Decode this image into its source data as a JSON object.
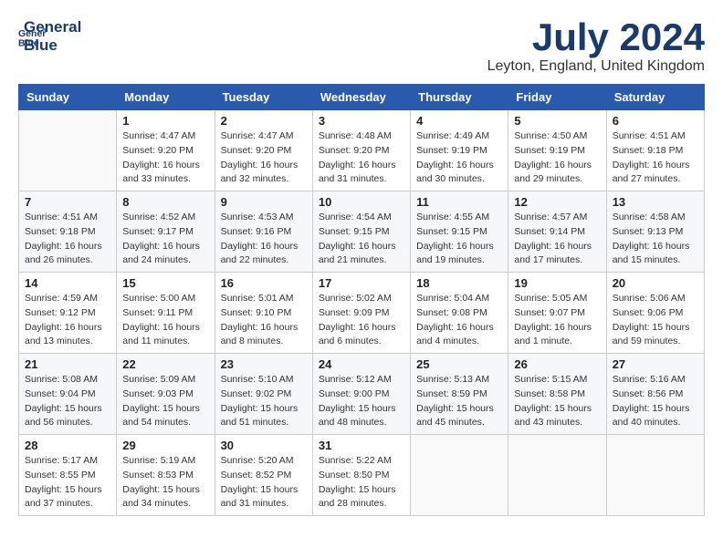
{
  "header": {
    "logo_line1": "General",
    "logo_line2": "Blue",
    "month": "July 2024",
    "location": "Leyton, England, United Kingdom"
  },
  "days_of_week": [
    "Sunday",
    "Monday",
    "Tuesday",
    "Wednesday",
    "Thursday",
    "Friday",
    "Saturday"
  ],
  "weeks": [
    [
      {
        "day": "",
        "sunrise": "",
        "sunset": "",
        "daylight": "",
        "empty": true
      },
      {
        "day": "1",
        "sunrise": "Sunrise: 4:47 AM",
        "sunset": "Sunset: 9:20 PM",
        "daylight": "Daylight: 16 hours and 33 minutes."
      },
      {
        "day": "2",
        "sunrise": "Sunrise: 4:47 AM",
        "sunset": "Sunset: 9:20 PM",
        "daylight": "Daylight: 16 hours and 32 minutes."
      },
      {
        "day": "3",
        "sunrise": "Sunrise: 4:48 AM",
        "sunset": "Sunset: 9:20 PM",
        "daylight": "Daylight: 16 hours and 31 minutes."
      },
      {
        "day": "4",
        "sunrise": "Sunrise: 4:49 AM",
        "sunset": "Sunset: 9:19 PM",
        "daylight": "Daylight: 16 hours and 30 minutes."
      },
      {
        "day": "5",
        "sunrise": "Sunrise: 4:50 AM",
        "sunset": "Sunset: 9:19 PM",
        "daylight": "Daylight: 16 hours and 29 minutes."
      },
      {
        "day": "6",
        "sunrise": "Sunrise: 4:51 AM",
        "sunset": "Sunset: 9:18 PM",
        "daylight": "Daylight: 16 hours and 27 minutes."
      }
    ],
    [
      {
        "day": "7",
        "sunrise": "Sunrise: 4:51 AM",
        "sunset": "Sunset: 9:18 PM",
        "daylight": "Daylight: 16 hours and 26 minutes."
      },
      {
        "day": "8",
        "sunrise": "Sunrise: 4:52 AM",
        "sunset": "Sunset: 9:17 PM",
        "daylight": "Daylight: 16 hours and 24 minutes."
      },
      {
        "day": "9",
        "sunrise": "Sunrise: 4:53 AM",
        "sunset": "Sunset: 9:16 PM",
        "daylight": "Daylight: 16 hours and 22 minutes."
      },
      {
        "day": "10",
        "sunrise": "Sunrise: 4:54 AM",
        "sunset": "Sunset: 9:15 PM",
        "daylight": "Daylight: 16 hours and 21 minutes."
      },
      {
        "day": "11",
        "sunrise": "Sunrise: 4:55 AM",
        "sunset": "Sunset: 9:15 PM",
        "daylight": "Daylight: 16 hours and 19 minutes."
      },
      {
        "day": "12",
        "sunrise": "Sunrise: 4:57 AM",
        "sunset": "Sunset: 9:14 PM",
        "daylight": "Daylight: 16 hours and 17 minutes."
      },
      {
        "day": "13",
        "sunrise": "Sunrise: 4:58 AM",
        "sunset": "Sunset: 9:13 PM",
        "daylight": "Daylight: 16 hours and 15 minutes."
      }
    ],
    [
      {
        "day": "14",
        "sunrise": "Sunrise: 4:59 AM",
        "sunset": "Sunset: 9:12 PM",
        "daylight": "Daylight: 16 hours and 13 minutes."
      },
      {
        "day": "15",
        "sunrise": "Sunrise: 5:00 AM",
        "sunset": "Sunset: 9:11 PM",
        "daylight": "Daylight: 16 hours and 11 minutes."
      },
      {
        "day": "16",
        "sunrise": "Sunrise: 5:01 AM",
        "sunset": "Sunset: 9:10 PM",
        "daylight": "Daylight: 16 hours and 8 minutes."
      },
      {
        "day": "17",
        "sunrise": "Sunrise: 5:02 AM",
        "sunset": "Sunset: 9:09 PM",
        "daylight": "Daylight: 16 hours and 6 minutes."
      },
      {
        "day": "18",
        "sunrise": "Sunrise: 5:04 AM",
        "sunset": "Sunset: 9:08 PM",
        "daylight": "Daylight: 16 hours and 4 minutes."
      },
      {
        "day": "19",
        "sunrise": "Sunrise: 5:05 AM",
        "sunset": "Sunset: 9:07 PM",
        "daylight": "Daylight: 16 hours and 1 minute."
      },
      {
        "day": "20",
        "sunrise": "Sunrise: 5:06 AM",
        "sunset": "Sunset: 9:06 PM",
        "daylight": "Daylight: 15 hours and 59 minutes."
      }
    ],
    [
      {
        "day": "21",
        "sunrise": "Sunrise: 5:08 AM",
        "sunset": "Sunset: 9:04 PM",
        "daylight": "Daylight: 15 hours and 56 minutes."
      },
      {
        "day": "22",
        "sunrise": "Sunrise: 5:09 AM",
        "sunset": "Sunset: 9:03 PM",
        "daylight": "Daylight: 15 hours and 54 minutes."
      },
      {
        "day": "23",
        "sunrise": "Sunrise: 5:10 AM",
        "sunset": "Sunset: 9:02 PM",
        "daylight": "Daylight: 15 hours and 51 minutes."
      },
      {
        "day": "24",
        "sunrise": "Sunrise: 5:12 AM",
        "sunset": "Sunset: 9:00 PM",
        "daylight": "Daylight: 15 hours and 48 minutes."
      },
      {
        "day": "25",
        "sunrise": "Sunrise: 5:13 AM",
        "sunset": "Sunset: 8:59 PM",
        "daylight": "Daylight: 15 hours and 45 minutes."
      },
      {
        "day": "26",
        "sunrise": "Sunrise: 5:15 AM",
        "sunset": "Sunset: 8:58 PM",
        "daylight": "Daylight: 15 hours and 43 minutes."
      },
      {
        "day": "27",
        "sunrise": "Sunrise: 5:16 AM",
        "sunset": "Sunset: 8:56 PM",
        "daylight": "Daylight: 15 hours and 40 minutes."
      }
    ],
    [
      {
        "day": "28",
        "sunrise": "Sunrise: 5:17 AM",
        "sunset": "Sunset: 8:55 PM",
        "daylight": "Daylight: 15 hours and 37 minutes."
      },
      {
        "day": "29",
        "sunrise": "Sunrise: 5:19 AM",
        "sunset": "Sunset: 8:53 PM",
        "daylight": "Daylight: 15 hours and 34 minutes."
      },
      {
        "day": "30",
        "sunrise": "Sunrise: 5:20 AM",
        "sunset": "Sunset: 8:52 PM",
        "daylight": "Daylight: 15 hours and 31 minutes."
      },
      {
        "day": "31",
        "sunrise": "Sunrise: 5:22 AM",
        "sunset": "Sunset: 8:50 PM",
        "daylight": "Daylight: 15 hours and 28 minutes."
      },
      {
        "day": "",
        "sunrise": "",
        "sunset": "",
        "daylight": "",
        "empty": true
      },
      {
        "day": "",
        "sunrise": "",
        "sunset": "",
        "daylight": "",
        "empty": true
      },
      {
        "day": "",
        "sunrise": "",
        "sunset": "",
        "daylight": "",
        "empty": true
      }
    ]
  ]
}
